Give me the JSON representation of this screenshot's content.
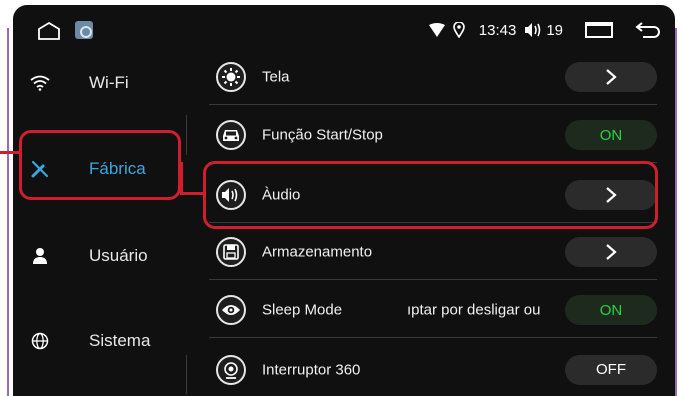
{
  "statusbar": {
    "time": "13:43",
    "volume": "19"
  },
  "sidebar": {
    "items": [
      {
        "label": "Wi-Fi",
        "icon": "wifi-icon"
      },
      {
        "label": "Fábrica",
        "icon": "wrench-screwdriver-icon",
        "active": true
      },
      {
        "label": "Usuário",
        "icon": "user-icon"
      },
      {
        "label": "Sistema",
        "icon": "globe-icon"
      }
    ]
  },
  "settings": {
    "rows": [
      {
        "label": "Tela",
        "icon": "brightness-icon",
        "control": "arrow"
      },
      {
        "label": "Função Start/Stop",
        "icon": "car-icon",
        "control": "ON"
      },
      {
        "label": "Àudio",
        "icon": "speaker-icon",
        "control": "arrow"
      },
      {
        "label": "Armazenamento",
        "icon": "floppy-disk-icon",
        "control": "arrow"
      },
      {
        "label": "Sleep Mode",
        "hint": "ıptar por desligar ou",
        "icon": "eye-icon",
        "control": "ON"
      },
      {
        "label": "Interruptor 360",
        "icon": "camera-icon",
        "control": "OFF"
      }
    ]
  },
  "colors": {
    "accent": "#3aa7e0",
    "on": "#28d23c",
    "highlight": "#cf1f2e",
    "background": "#101010"
  }
}
